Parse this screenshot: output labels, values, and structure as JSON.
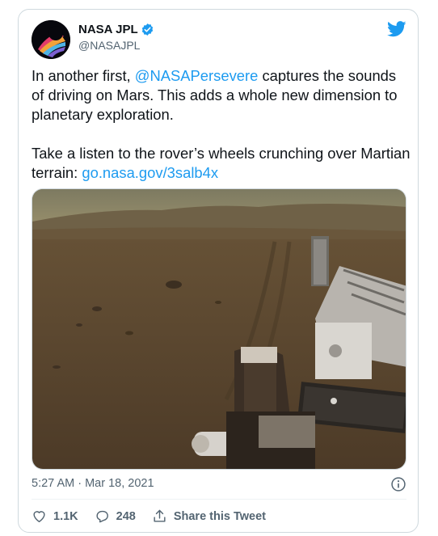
{
  "author": {
    "name": "NASA JPL",
    "handle": "@NASAJPL",
    "verified": true
  },
  "tweet": {
    "line1_pre": "In another first, ",
    "mention": "@NASAPersevere",
    "line1_post": " captures the sounds of driving on Mars. This adds a whole new dimension to planetary exploration.",
    "line2_pre": "Take a listen to the rover’s wheels crunching over Martian terrain: ",
    "link": "go.nasa.gov/3salb4x"
  },
  "meta": {
    "timestamp": "5:27 AM · Mar 18, 2021"
  },
  "actions": {
    "likes": "1.1K",
    "replies": "248",
    "share_label": "Share this Tweet"
  },
  "colors": {
    "accent": "#1d9bf0",
    "text": "#0f1419",
    "muted": "#536471",
    "border": "#cfd9de"
  },
  "icons": [
    "verified-badge-icon",
    "twitter-bird-icon",
    "info-icon",
    "heart-icon",
    "reply-icon",
    "share-icon"
  ]
}
